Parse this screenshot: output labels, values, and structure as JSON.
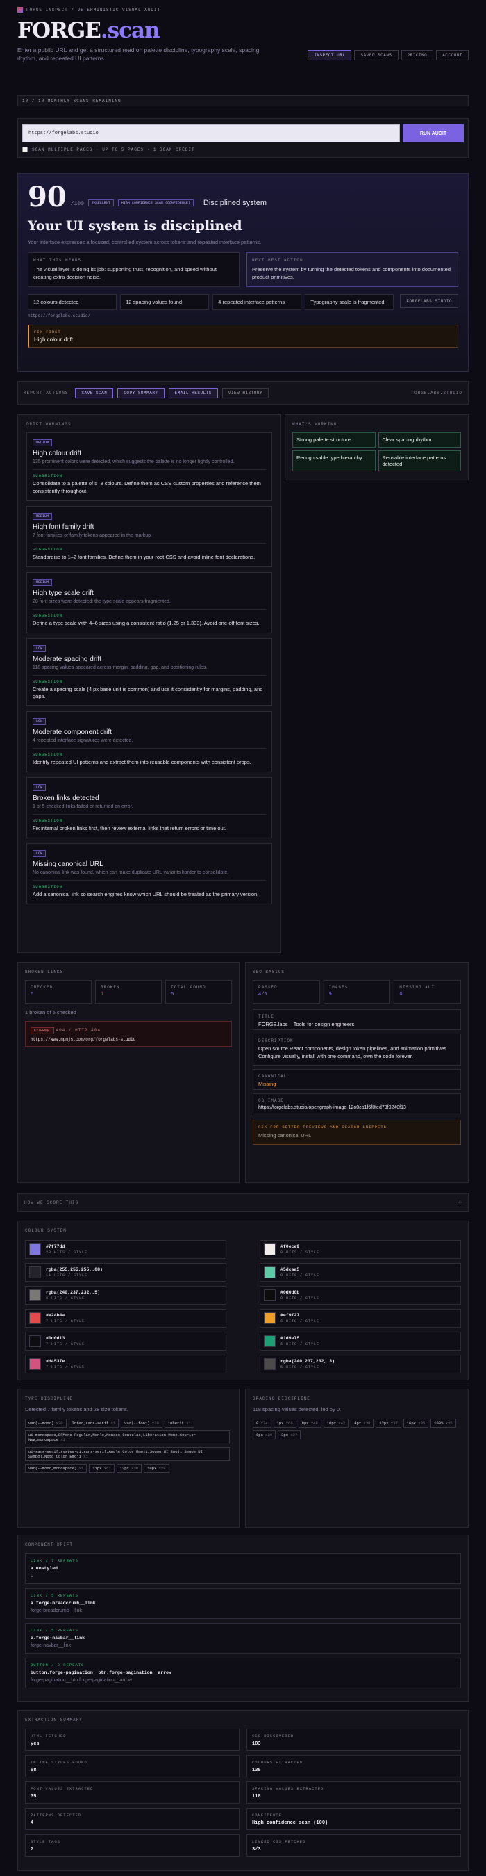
{
  "brand": {
    "header": "FORGE INSPECT / DETERMINISTIC VISUAL AUDIT",
    "name_a": "FORGE",
    "name_b": ".scan",
    "tagline": "Enter a public URL and get a structured read on palette discipline, typography scale, spacing rhythm, and repeated UI patterns."
  },
  "nav": [
    "INSPECT URL",
    "SAVED SCANS",
    "PRICING",
    "ACCOUNT"
  ],
  "scans_remaining": "10 / 10 MONTHLY SCANS REMAINING",
  "url_input": {
    "value": "https://forgelabs.studio",
    "button": "RUN AUDIT",
    "checkbox_label": "SCAN MULTIPLE PAGES · UP TO 5 PAGES · 1 SCAN CREDIT"
  },
  "score": {
    "value": "90",
    "denom": "/100",
    "badge_a": "EXCELLENT",
    "badge_b": "HIGH CONFIDENCE SCAN (CONFIDENCE)",
    "system": "Disciplined system",
    "headline": "Your UI system is disciplined",
    "subline": "Your interface expresses a focused, controlled system across tokens and repeated interface patterns.",
    "means_label": "WHAT THIS MEANS",
    "means_text": "The visual layer is doing its job: supporting trust, recognition, and speed without creating extra decision noise.",
    "next_label": "NEXT BEST ACTION",
    "next_text": "Preserve the system by turning the detected tokens and components into documented product primitives.",
    "stats": [
      "12 colours detected",
      "12 spacing values found",
      "4 repeated interface patterns",
      "Typography scale is fragmented"
    ],
    "domain_btn": "FORGELABS.STUDIO",
    "url": "https://forgelabs.studio/",
    "fix_label": "FIX FIRST",
    "fix_text": "High colour drift"
  },
  "report_actions": {
    "label": "REPORT ACTIONS",
    "buttons": [
      "SAVE SCAN",
      "COPY SUMMARY",
      "EMAIL RESULTS",
      "VIEW HISTORY"
    ],
    "domain": "FORGELABS.STUDIO"
  },
  "drift": {
    "label": "DRIFT WARNINGS",
    "items": [
      {
        "sev": "MEDIUM",
        "title": "High colour drift",
        "desc": "135 prominent colors were detected, which suggests the palette is no longer tightly controlled.",
        "suggestion": "Consolidate to a palette of 5–8 colours. Define them as CSS custom properties and reference them consistently throughout."
      },
      {
        "sev": "MEDIUM",
        "title": "High font family drift",
        "desc": "7 font families or family tokens appeared in the markup.",
        "suggestion": "Standardise to 1–2 font families. Define them in your root CSS and avoid inline font declarations."
      },
      {
        "sev": "MEDIUM",
        "title": "High type scale drift",
        "desc": "28 font sizes were detected; the type scale appears fragmented.",
        "suggestion": "Define a type scale with 4–6 sizes using a consistent ratio (1.25 or 1.333). Avoid one-off font sizes."
      },
      {
        "sev": "LOW",
        "title": "Moderate spacing drift",
        "desc": "118 spacing values appeared across margin, padding, gap, and positioning rules.",
        "suggestion": "Create a spacing scale (4 px base unit is common) and use it consistently for margins, padding, and gaps."
      },
      {
        "sev": "LOW",
        "title": "Moderate component drift",
        "desc": "4 repeated interface signatures were detected.",
        "suggestion": "Identify repeated UI patterns and extract them into reusable components with consistent props."
      },
      {
        "sev": "LOW",
        "title": "Broken links detected",
        "desc": "1 of 5 checked links failed or returned an error.",
        "suggestion": "Fix internal broken links first, then review external links that return errors or time out."
      },
      {
        "sev": "LOW",
        "title": "Missing canonical URL",
        "desc": "No canonical link was found, which can make duplicate URL variants harder to consolidate.",
        "suggestion": "Add a canonical link so search engines know which URL should be treated as the primary version."
      }
    ],
    "suggestion_label": "SUGGESTION"
  },
  "working": {
    "label": "WHAT'S WORKING",
    "items": [
      "Strong palette structure",
      "Clear spacing rhythm",
      "Recognisable type hierarchy",
      "Reusable interface patterns detected"
    ]
  },
  "broken_links": {
    "label": "BROKEN LINKS",
    "stats": [
      {
        "k": "CHECKED",
        "v": "5"
      },
      {
        "k": "BROKEN",
        "v": "1"
      },
      {
        "k": "TOTAL FOUND",
        "v": "5"
      }
    ],
    "summary": "1 broken of 5 checked",
    "err_tag": "EXTERNAL",
    "err_code": "404 / HTTP 404",
    "err_url": "https://www.npmjs.com/org/forgelabs-studio"
  },
  "seo": {
    "label": "SEO BASICS",
    "stats": [
      {
        "k": "PASSED",
        "v": "4/5"
      },
      {
        "k": "IMAGES",
        "v": "9"
      },
      {
        "k": "MISSING ALT",
        "v": "0"
      }
    ],
    "fields": [
      {
        "k": "TITLE",
        "v": "FORGE.labs – Tools for design engineers",
        "state": "ok"
      },
      {
        "k": "DESCRIPTION",
        "v": "Open source React components, design token pipelines, and animation primitives. Configure visually, install with one command, own the code forever.",
        "state": "ok"
      },
      {
        "k": "CANONICAL",
        "v": "Missing",
        "state": "warn"
      },
      {
        "k": "OG IMAGE",
        "v": "https://forgelabs.studio/opengraph-image-12o0cb1f6f8fed73f9240f13",
        "state": "ok"
      }
    ],
    "fix_title": "FIX FOR BETTER PREVIEWS AND SEARCH SNIPPETS",
    "fix_text": "Missing canonical URL"
  },
  "how": {
    "label": "HOW WE SCORE THIS",
    "icon": "+"
  },
  "colours": {
    "label": "COLOUR SYSTEM",
    "items": [
      {
        "hex": "#7f77dd",
        "meta": "20 HITS / STYLE",
        "c": "#7f77dd"
      },
      {
        "hex": "#f0ece9",
        "meta": "9 HITS / STYLE",
        "c": "#f0ece9"
      },
      {
        "hex": "rgba(255,255,255,.08)",
        "meta": "11 HITS / STYLE",
        "c": "#24222a"
      },
      {
        "hex": "#5dcaa5",
        "meta": "8 HITS / STYLE",
        "c": "#5dcaa5"
      },
      {
        "hex": "rgba(240,237,232,.5)",
        "meta": "8 HITS / STYLE",
        "c": "#7a7875"
      },
      {
        "hex": "#0d0d0b",
        "meta": "8 HITS / STYLE",
        "c": "#0d0d0b"
      },
      {
        "hex": "#e24b4a",
        "meta": "7 HITS / STYLE",
        "c": "#e24b4a"
      },
      {
        "hex": "#ef9f27",
        "meta": "6 HITS / STYLE",
        "c": "#ef9f27"
      },
      {
        "hex": "#0d0d13",
        "meta": "7 HITS / STYLE",
        "c": "#0d0d13"
      },
      {
        "hex": "#1d9e75",
        "meta": "6 HITS / STYLE",
        "c": "#1d9e75"
      },
      {
        "hex": "#d4537e",
        "meta": "7 HITS / STYLE",
        "c": "#d4537e"
      },
      {
        "hex": "rgba(240,237,232,.3)",
        "meta": "5 HITS / STYLE",
        "c": "#4d4b49"
      }
    ]
  },
  "type": {
    "label": "TYPE DISCIPLINE",
    "summary": "Detected 7 family tokens and 28 size tokens.",
    "rows": [
      [
        {
          "t": "var(--mono)",
          "n": "x30"
        },
        {
          "t": "Inter,sans-serif",
          "n": "x1"
        },
        {
          "t": "var(--font)",
          "n": "x30"
        },
        {
          "t": "inherit",
          "n": "x1"
        }
      ],
      [
        {
          "t": "ui-monospace,SFMono-Regular,Menlo,Monaco,Consolas,Liberation Mono,Courier New,monospace",
          "n": "x1"
        }
      ],
      [
        {
          "t": "ui-sans-serif,system-ui,sans-serif,Apple Color Emoji,Segoe UI Emoji,Segoe UI Symbol,Noto Color Emoji",
          "n": "x1"
        }
      ],
      [
        {
          "t": "var(--mono,monospace)",
          "n": "x1"
        },
        {
          "t": "11px",
          "n": "x61"
        },
        {
          "t": "13px",
          "n": "x38"
        },
        {
          "t": "10px",
          "n": "x28"
        }
      ]
    ]
  },
  "spacing": {
    "label": "SPACING DISCIPLINE",
    "summary": "118 spacing values detected, led by 0.",
    "chips": [
      {
        "t": "0",
        "n": "x74"
      },
      {
        "t": "1px",
        "n": "x66"
      },
      {
        "t": "8px",
        "n": "x48"
      },
      {
        "t": "10px",
        "n": "x42"
      },
      {
        "t": "4px",
        "n": "x38"
      },
      {
        "t": "12px",
        "n": "x37"
      },
      {
        "t": "16px",
        "n": "x35"
      },
      {
        "t": "100%",
        "n": "x35"
      },
      {
        "t": "6px",
        "n": "x29"
      },
      {
        "t": "3px",
        "n": "x27"
      }
    ]
  },
  "components": {
    "label": "COMPONENT DRIFT",
    "items": [
      {
        "kind": "LINK / 7 REPEATS",
        "sel": "a.unstyled",
        "sample": "0"
      },
      {
        "kind": "LINK / 5 REPEATS",
        "sel": "a.forge-breadcrumb__link",
        "sample": "forge-breadcrumb__link"
      },
      {
        "kind": "LINK / 5 REPEATS",
        "sel": "a.forge-navbar__link",
        "sample": "forge-navbar__link"
      },
      {
        "kind": "BUTTON / 2 REPEATS",
        "sel": "button.forge-pagination__btn.forge-pagination__arrow",
        "sample": "forge-pagination__btn forge-pagination__arrow"
      }
    ]
  },
  "extraction": {
    "label": "EXTRACTION SUMMARY",
    "items": [
      {
        "k": "HTML FETCHED",
        "v": "yes"
      },
      {
        "k": "CSS DISCOVERED",
        "v": "103"
      },
      {
        "k": "INLINE STYLES FOUND",
        "v": "98"
      },
      {
        "k": "COLOURS EXTRACTED",
        "v": "135"
      },
      {
        "k": "FONT VALUES EXTRACTED",
        "v": "35"
      },
      {
        "k": "SPACING VALUES EXTRACTED",
        "v": "118"
      },
      {
        "k": "PATTERNS DETECTED",
        "v": "4"
      },
      {
        "k": "CONFIDENCE",
        "v": "High confidence scan (100)"
      },
      {
        "k": "STYLE TAGS",
        "v": "2"
      },
      {
        "k": "LINKED CSS FETCHED",
        "v": "3/3"
      }
    ]
  },
  "colors": {
    "accent": "#7b62e0",
    "ok": "#33c07a",
    "warn": "#e89a4a",
    "bg": "#0d0b13"
  }
}
